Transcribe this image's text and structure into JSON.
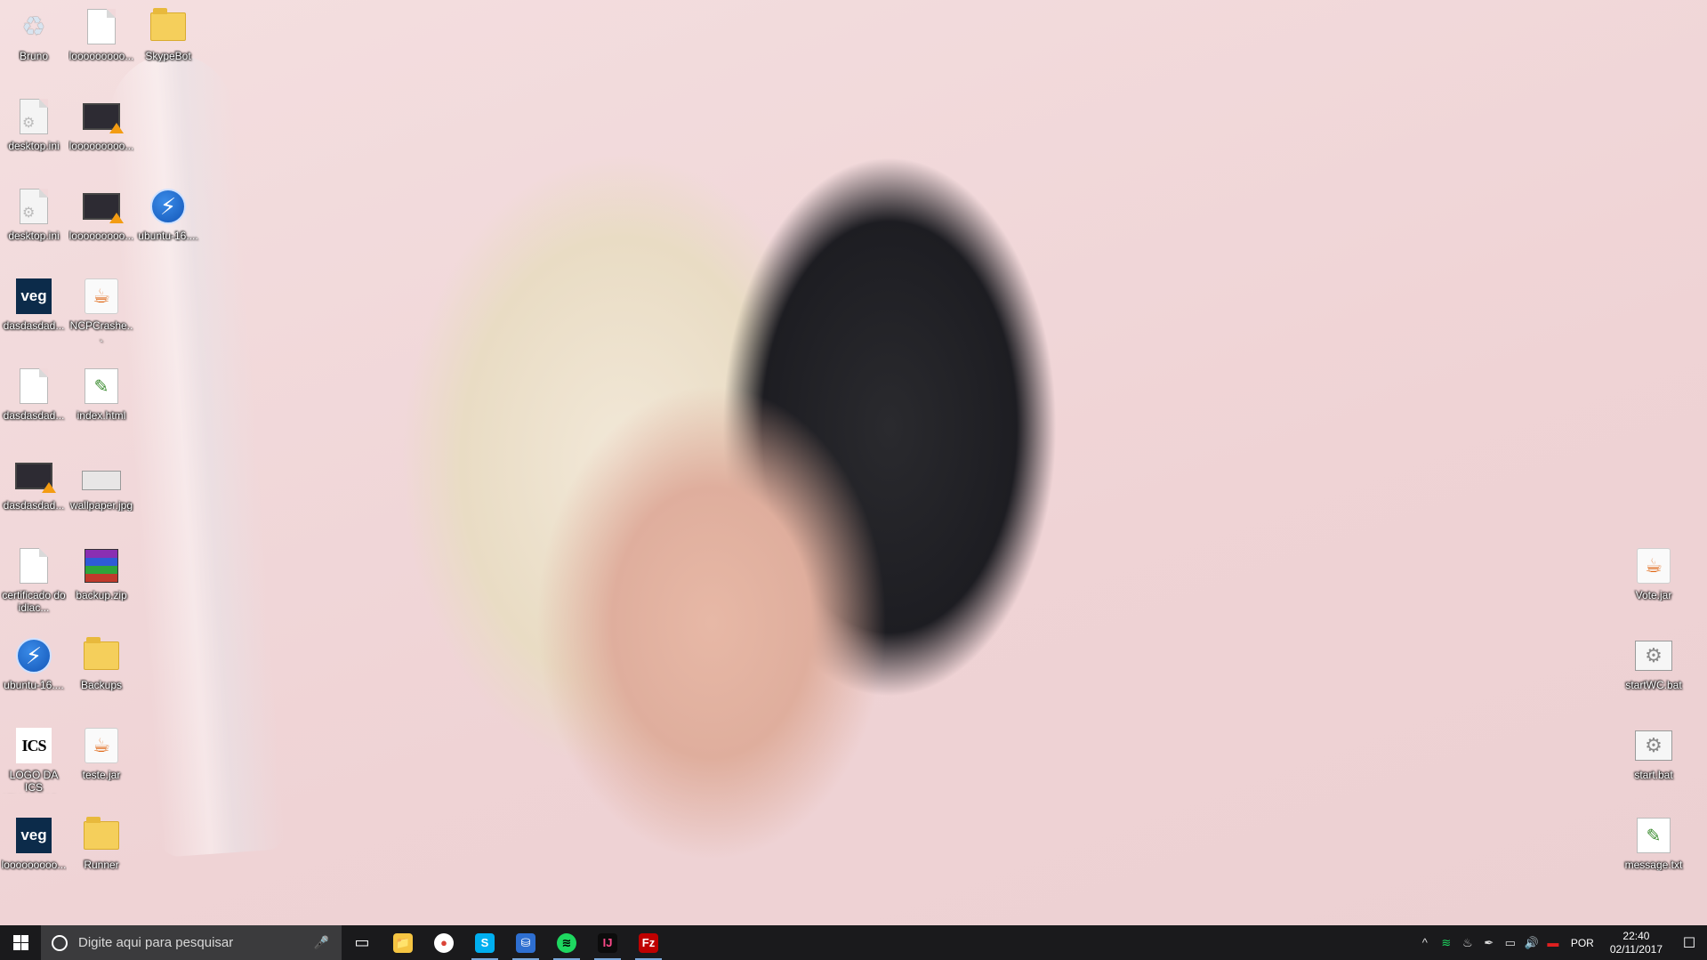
{
  "desktop": {
    "icons": [
      {
        "label": "Bruno",
        "type": "recycle",
        "glyph": "♻"
      },
      {
        "label": "looooooooo...",
        "type": "doc"
      },
      {
        "label": "SkypeBot",
        "type": "folder"
      },
      {
        "label": "desktop.ini",
        "type": "ini"
      },
      {
        "label": "looooooooo...",
        "type": "video"
      },
      {
        "label": "desktop.ini",
        "type": "ini"
      },
      {
        "label": "looooooooo...",
        "type": "video"
      },
      {
        "label": "ubuntu-16....",
        "type": "ubuntu",
        "glyph": "⚡"
      },
      {
        "label": "dasdasdad...",
        "type": "veg",
        "glyph": "veg"
      },
      {
        "label": "NCPCrashe...",
        "type": "java",
        "glyph": "☕"
      },
      {
        "label": "dasdasdad...",
        "type": "doc"
      },
      {
        "label": "index.html",
        "type": "html",
        "glyph": "✎"
      },
      {
        "label": "dasdasdad...",
        "type": "video"
      },
      {
        "label": "wallpaper.jpg",
        "type": "jpg"
      },
      {
        "label": "certificado do idiac...",
        "type": "doc"
      },
      {
        "label": "backup.zip",
        "type": "zip"
      },
      {
        "label": "ubuntu-16....",
        "type": "ubuntu",
        "glyph": "⚡"
      },
      {
        "label": "Backups",
        "type": "folder"
      },
      {
        "label": "LOGO DA ICS ATUALIZAD...",
        "type": "ics",
        "glyph": "ICS"
      },
      {
        "label": "teste.jar",
        "type": "java",
        "glyph": "☕"
      },
      {
        "label": "looooooooo...",
        "type": "veg",
        "glyph": "veg"
      },
      {
        "label": "Runner",
        "type": "folder"
      },
      {
        "label": "Vote.jar",
        "type": "java",
        "glyph": "☕"
      },
      {
        "label": "startWC.bat",
        "type": "bat",
        "glyph": "⚙"
      },
      {
        "label": "start.bat",
        "type": "bat",
        "glyph": "⚙"
      },
      {
        "label": "message.txt",
        "type": "html",
        "glyph": "✎"
      }
    ]
  },
  "taskbar": {
    "search_placeholder": "Digite aqui para pesquisar",
    "mic_glyph": "🎤",
    "task_view_glyph": "▭",
    "apps": [
      {
        "name": "file-explorer",
        "glyph": "📁",
        "bg": "#f5c542",
        "fg": "#7a5a00"
      },
      {
        "name": "chrome",
        "glyph": "●",
        "bg": "#ffffff",
        "fg": "#db4437"
      },
      {
        "name": "skype",
        "glyph": "S",
        "bg": "#00aff0",
        "fg": "#ffffff"
      },
      {
        "name": "network-app",
        "glyph": "⛁",
        "bg": "#2e6fd1",
        "fg": "#ffffff"
      },
      {
        "name": "spotify",
        "glyph": "≋",
        "bg": "#1ed760",
        "fg": "#000000"
      },
      {
        "name": "intellij",
        "glyph": "IJ",
        "bg": "#0c0c0c",
        "fg": "#ff4a8a"
      },
      {
        "name": "filezilla",
        "glyph": "Fz",
        "bg": "#bf0000",
        "fg": "#ffffff"
      }
    ],
    "tray": {
      "chevron": "^",
      "icons": [
        "≋",
        "♨",
        "✒",
        "▭",
        "🔊",
        "▬"
      ],
      "language": "POR",
      "time": "22:40",
      "date": "02/11/2017",
      "notification_glyph": "☐"
    }
  }
}
